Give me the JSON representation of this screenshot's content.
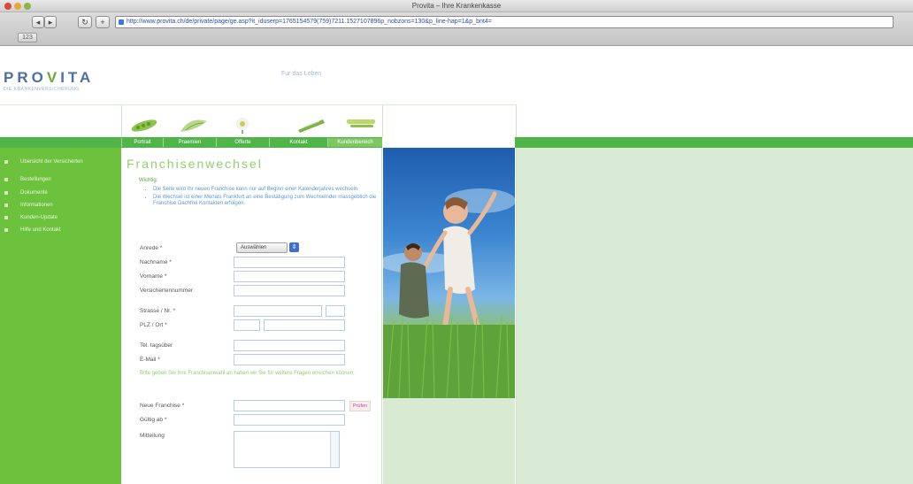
{
  "browser": {
    "window_title": "Provita – Ihre Krankenkasse",
    "url": "http://www.provita.ch/de/private/page/ge.asp?it_iduserp=1765154579(759)7211.1527107896p_nobzons=130&p_line-hap=1&p_bnt4=",
    "bookmark_label": "123"
  },
  "header": {
    "logo_text_left": "PRO",
    "logo_v": "V",
    "logo_text_right": "ITA",
    "logo_sub": "DIE KRANKENVERSICHERUNG",
    "tagline": "Fur das Leben"
  },
  "nav": {
    "tabs": [
      "Portrait",
      "Praemien",
      "Offerte",
      "Kontakt",
      "Kundenbereich"
    ]
  },
  "sidebar": {
    "items": [
      {
        "label": "Ubersicht der Versicherten"
      },
      {
        "label": "Bestellungen"
      },
      {
        "label": "Dokumente"
      },
      {
        "label": "Informationen"
      },
      {
        "label": "Kunden-Update"
      },
      {
        "label": "Hilfe und Kontakt"
      }
    ]
  },
  "main": {
    "title": "Franchisenwechsel",
    "hint_head": "Wichtig:",
    "hints": [
      "Die Seite wird Ihr neuen Franchise kann nur auf Beginn einer Kalenderjahres wechseln.",
      "Die Wechsel ist einer Monats Frankfurt an eine Bestätigung zum Wechselnder massgeblich die Franchise Dachfrei Kontakten erfolgen."
    ],
    "form": {
      "salutation_label": "Anrede *",
      "salutation_value": "Auswählen",
      "lastname_label": "Nachname *",
      "firstname_label": "Vorname *",
      "insurance_no_label": "Versichertennummer",
      "street_label": "Strasse / Nr. *",
      "zip_label": "PLZ / Ort *",
      "phone_label": "Tel. tagsüber",
      "email_label": "E-Mail *",
      "note": "Bitte geben Sie Ihre Franchisenwahl an haben wir Sie für weitere Fragen erreichen können.",
      "new_franchise_label": "Neue Franchise *",
      "valid_from_label": "Gültig ab *",
      "remarks_label": "Mitteilung",
      "check_button": "Prüfen"
    }
  }
}
